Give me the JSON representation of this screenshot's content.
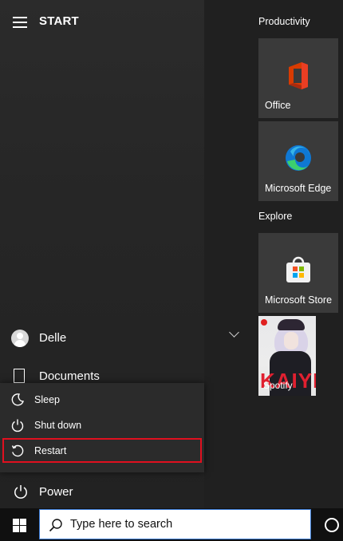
{
  "start": {
    "title": "START",
    "user_name": "Delle",
    "documents_label": "Documents",
    "power_label": "Power"
  },
  "power_menu": {
    "items": [
      {
        "label": "Sleep",
        "icon": "moon-icon"
      },
      {
        "label": "Shut down",
        "icon": "power-icon"
      },
      {
        "label": "Restart",
        "icon": "restart-icon",
        "highlighted": true
      }
    ],
    "highlight_color": "#e0101f"
  },
  "groups": {
    "productivity": {
      "label": "Productivity",
      "tiles": [
        {
          "label": "Office",
          "icon": "office-icon"
        },
        {
          "label": "Microsoft Edge",
          "icon": "edge-icon"
        }
      ]
    },
    "explore": {
      "label": "Explore",
      "tiles": [
        {
          "label": "Microsoft Store",
          "icon": "store-icon"
        },
        {
          "label": "Spotify",
          "icon": "spotify-album-art",
          "art_text": "KAIYE"
        }
      ]
    }
  },
  "taskbar": {
    "search_placeholder": "Type here to search"
  },
  "colors": {
    "tile_bg": "#3a3a3a",
    "search_border": "#3a7bd5",
    "office_red": "#d83b01",
    "edge_blue": "#0f78d4",
    "edge_green": "#3ccf6e"
  }
}
